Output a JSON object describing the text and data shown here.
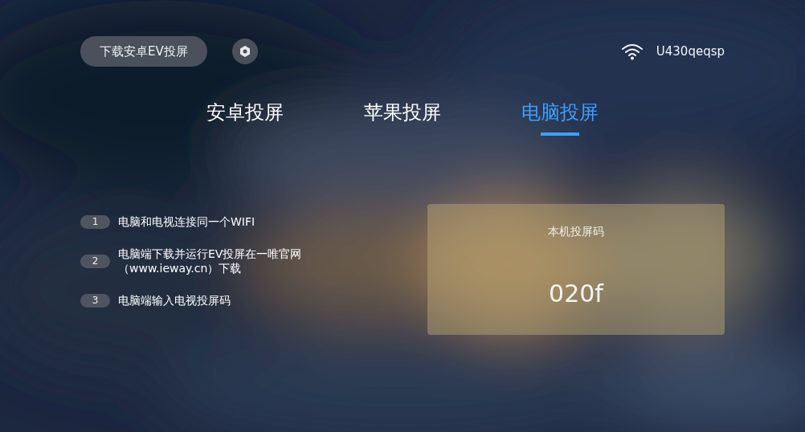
{
  "top_bar": {
    "download_button": "下载安卓EV投屏",
    "network": "U430qeqsp"
  },
  "tabs": [
    {
      "label": "安卓投屏",
      "selected": false
    },
    {
      "label": "苹果投屏",
      "selected": false
    },
    {
      "label": "电脑投屏",
      "selected": true
    }
  ],
  "steps": [
    {
      "number": "1",
      "text": "电脑和电视连接同一个WIFI"
    },
    {
      "number": "2",
      "text": "电脑端下载并运行EV投屏在一唯官网（www.ieway.cn）下载"
    },
    {
      "number": "3",
      "text": "电脑端输入电视投屏码"
    }
  ],
  "code_card": {
    "title": "本机投屏码",
    "code": "020f"
  }
}
